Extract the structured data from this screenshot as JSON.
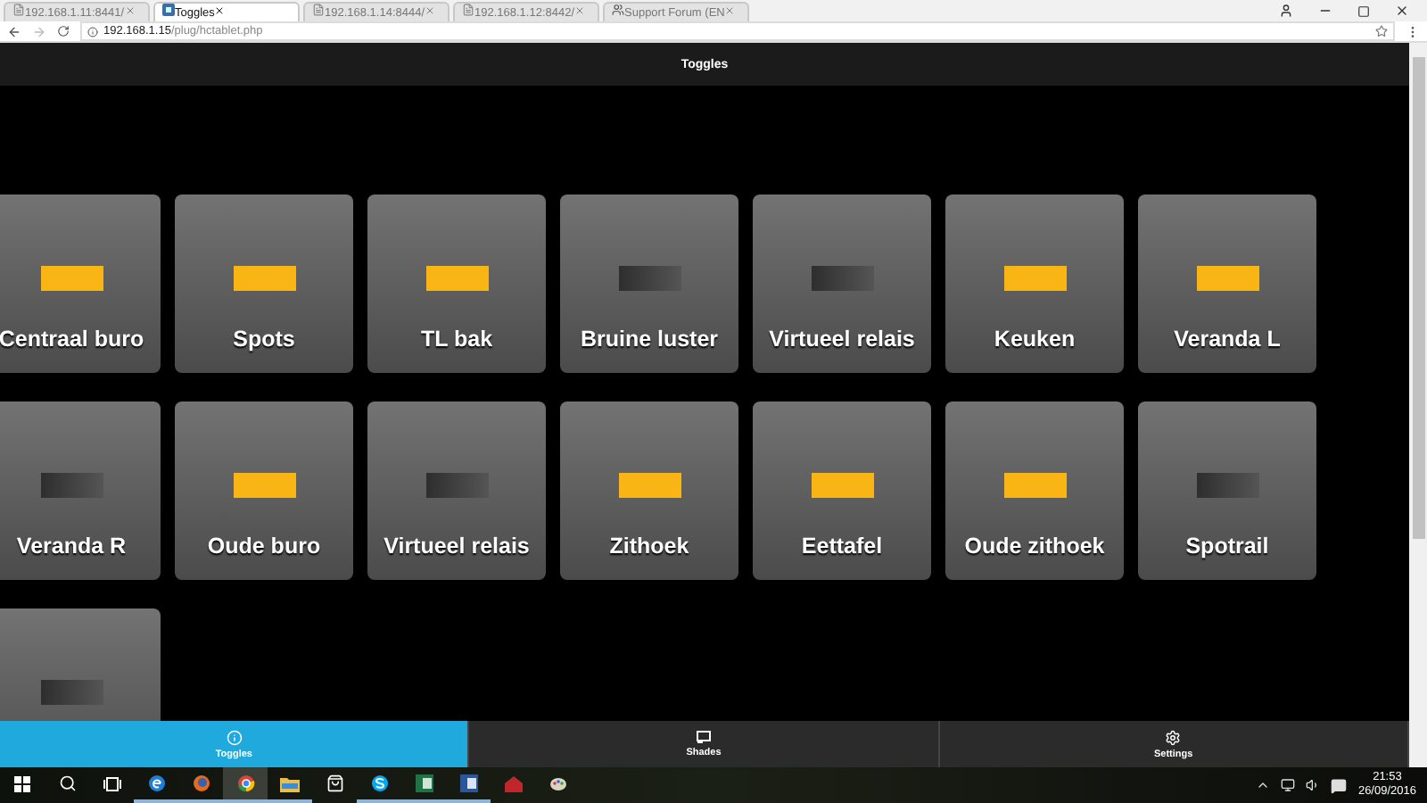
{
  "browser": {
    "tabs": [
      {
        "title": "192.168.1.11:8441/",
        "selected": false,
        "kind": "page"
      },
      {
        "title": "Toggles",
        "selected": true,
        "kind": "app"
      },
      {
        "title": "192.168.1.14:8444/",
        "selected": false,
        "kind": "page"
      },
      {
        "title": "192.168.1.12:8442/",
        "selected": false,
        "kind": "page"
      },
      {
        "title": "Support Forum (EN",
        "selected": false,
        "kind": "forum"
      }
    ],
    "address": {
      "host": "192.168.1.15",
      "path": "/plug/hctablet.php"
    }
  },
  "header": {
    "title": "Toggles"
  },
  "tiles": [
    {
      "label": "Centraal buro",
      "on": true
    },
    {
      "label": "Spots",
      "on": true
    },
    {
      "label": "TL bak",
      "on": true
    },
    {
      "label": "Bruine luster",
      "on": false
    },
    {
      "label": "Virtueel relais",
      "on": false
    },
    {
      "label": "Keuken",
      "on": true
    },
    {
      "label": "Veranda L",
      "on": true
    },
    {
      "label": "Veranda R",
      "on": false
    },
    {
      "label": "Oude buro",
      "on": true
    },
    {
      "label": "Virtueel relais",
      "on": false
    },
    {
      "label": "Zithoek",
      "on": true
    },
    {
      "label": "Eettafel",
      "on": true
    },
    {
      "label": "Oude zithoek",
      "on": true
    },
    {
      "label": "Spotrail",
      "on": false
    },
    {
      "on": false
    }
  ],
  "nav": [
    {
      "label": "Toggles",
      "kind": "toggles",
      "selected": true
    },
    {
      "label": "Shades",
      "kind": "shades",
      "selected": false
    },
    {
      "label": "Settings",
      "kind": "settings",
      "selected": false
    }
  ],
  "taskbar": {
    "apps": [
      {
        "kind": "start",
        "running": false
      },
      {
        "kind": "search",
        "running": false
      },
      {
        "kind": "taskview",
        "running": false
      },
      {
        "kind": "edge",
        "running": true
      },
      {
        "kind": "firefox",
        "running": true
      },
      {
        "kind": "chrome",
        "running": true
      },
      {
        "kind": "folder",
        "running": true
      },
      {
        "kind": "store",
        "running": false
      },
      {
        "kind": "skype",
        "running": true
      },
      {
        "kind": "sheet",
        "running": true
      },
      {
        "kind": "doc",
        "running": true
      },
      {
        "kind": "house",
        "running": false
      },
      {
        "kind": "paint",
        "running": false
      }
    ],
    "time": "21:53",
    "date": "26/09/2016"
  }
}
